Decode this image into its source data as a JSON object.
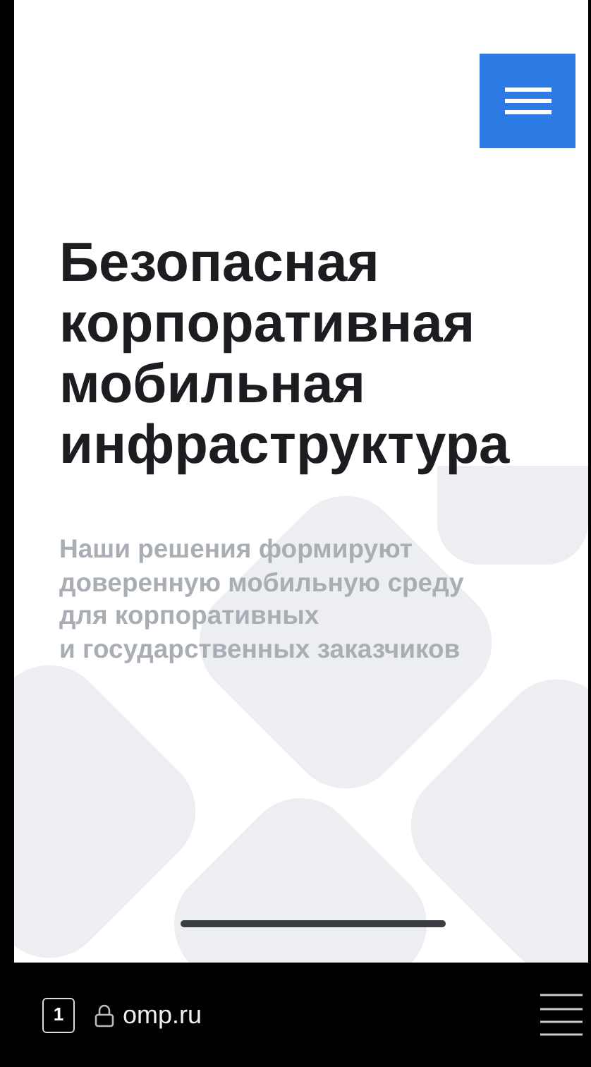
{
  "hero": {
    "title": "Безопасная корпоративная мобильная инфраструктура",
    "subtitle_lines": [
      "Наши решения формируют",
      "доверенную мобильную среду",
      "для корпоративных",
      "и государственных заказчиков"
    ]
  },
  "browser_bar": {
    "tab_count": "1",
    "address": "omp.ru"
  }
}
